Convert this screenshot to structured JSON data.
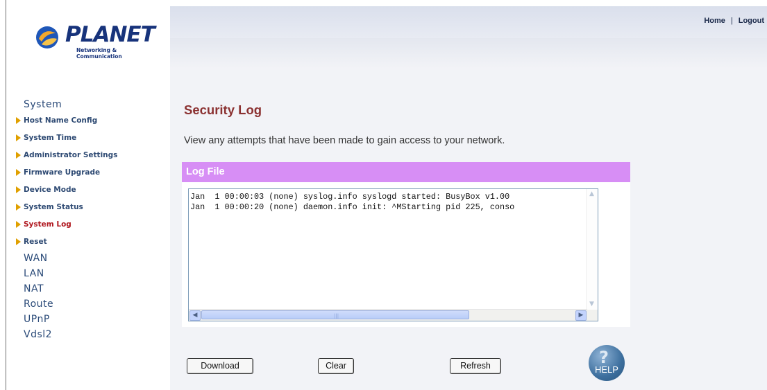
{
  "brand": {
    "name": "PLANET",
    "tagline": "Networking & Communication"
  },
  "header": {
    "home_label": "Home",
    "separator": "|",
    "logout_label": "Logout"
  },
  "sidebar": {
    "system_label": "System",
    "system_items": [
      {
        "label": "Host Name Config"
      },
      {
        "label": "System Time"
      },
      {
        "label": "Administrator Settings"
      },
      {
        "label": "Firmware Upgrade"
      },
      {
        "label": "Device Mode"
      },
      {
        "label": "System Status"
      },
      {
        "label": "System Log",
        "active": true
      },
      {
        "label": "Reset"
      }
    ],
    "categories": [
      {
        "label": "WAN"
      },
      {
        "label": "LAN"
      },
      {
        "label": "NAT"
      },
      {
        "label": "Route"
      },
      {
        "label": "UPnP"
      },
      {
        "label": "Vdsl2"
      }
    ]
  },
  "main": {
    "title": "Security Log",
    "description": "View any attempts that have been made to gain access to your network.",
    "log_file": {
      "header": "Log File",
      "lines": [
        "Jan  1 00:00:03 (none) syslog.info syslogd started: BusyBox v1.00",
        "Jan  1 00:00:20 (none) daemon.info init: ^MStarting pid 225, conso"
      ]
    },
    "buttons": {
      "download": "Download",
      "clear": "Clear",
      "refresh": "Refresh"
    },
    "help_label": "HELP"
  },
  "colors": {
    "title": "#8b3131",
    "log_header_bg": "#d78ef5",
    "active_menu": "#b0171f",
    "menu_text": "#2e4a73",
    "arrow": "#e0a000"
  }
}
